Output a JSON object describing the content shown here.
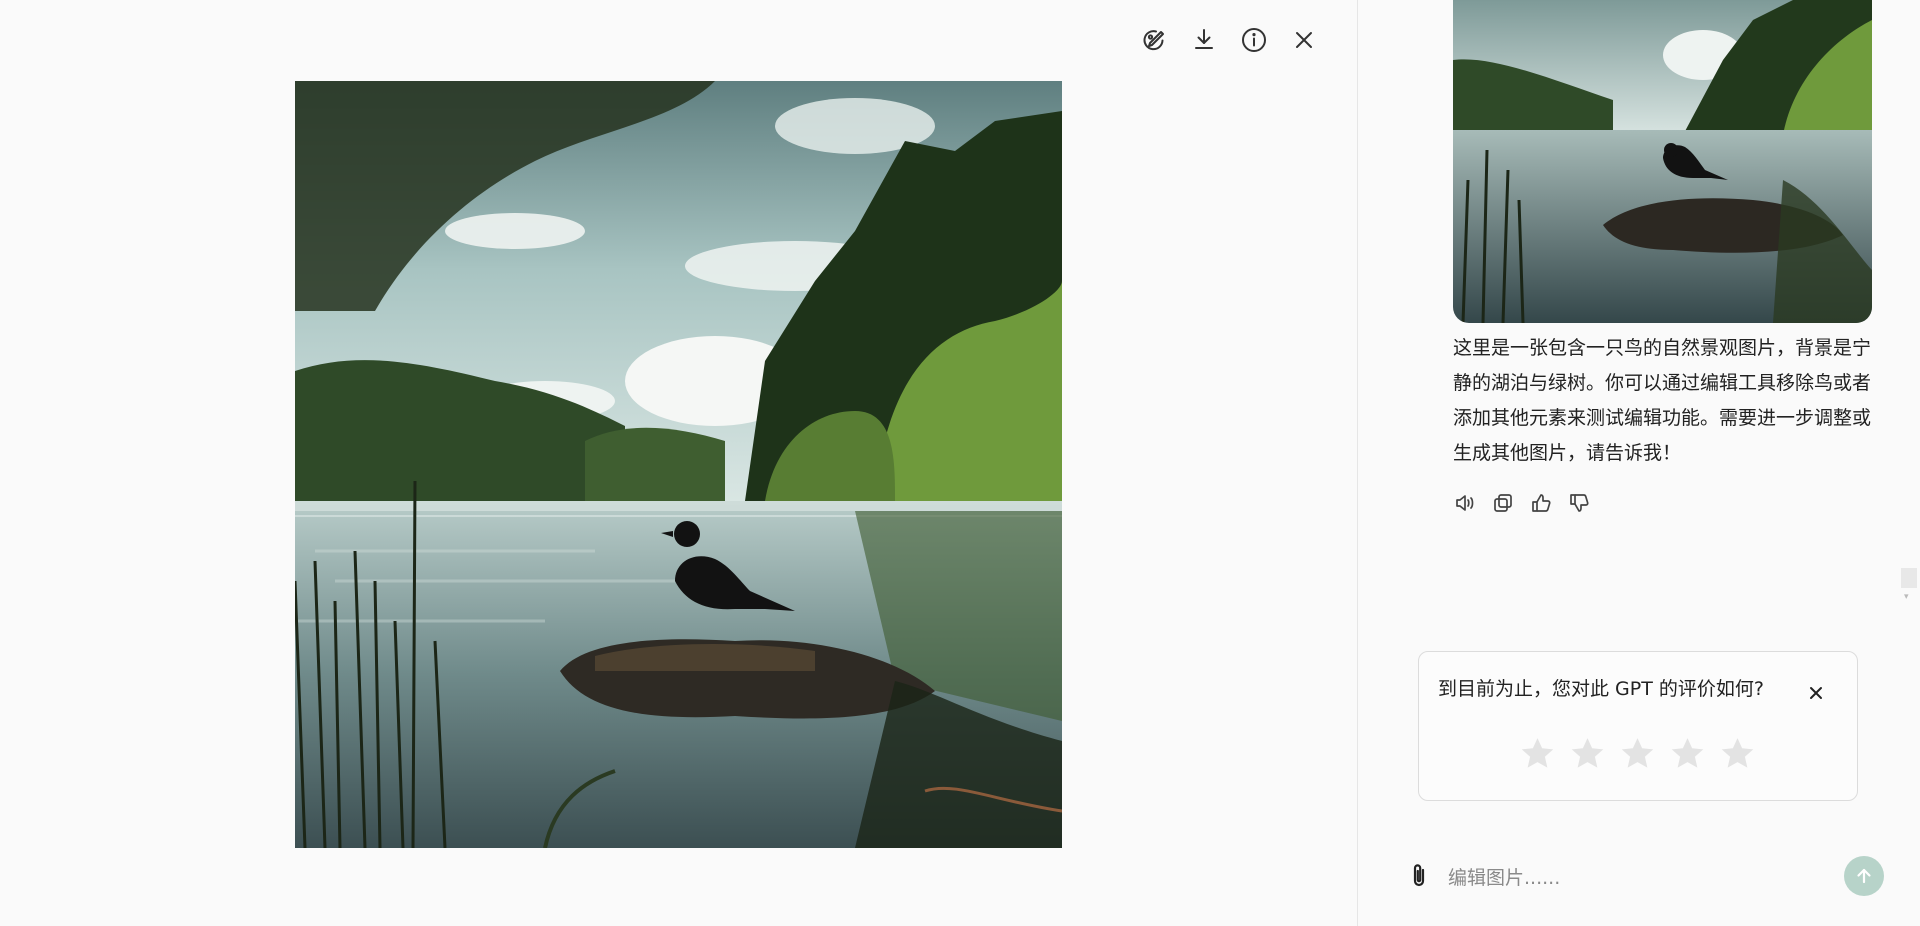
{
  "toolbar": {
    "buttons": [
      {
        "icon": "edit-image-icon"
      },
      {
        "icon": "download-icon"
      },
      {
        "icon": "info-icon"
      },
      {
        "icon": "close-icon"
      }
    ]
  },
  "preview": {
    "subject": "bird-on-rock-lake-scene"
  },
  "chat": {
    "message": "这里是一张包含一只鸟的自然景观图片，背景是宁静的湖泊与绿树。你可以通过编辑工具移除鸟或者添加其他元素来测试编辑功能。需要进一步调整或生成其他图片，请告诉我！",
    "actions": [
      "read-aloud-icon",
      "copy-icon",
      "thumbs-up-icon",
      "thumbs-down-icon"
    ]
  },
  "rating": {
    "question": "到目前为止，您对此 GPT 的评价如何?",
    "stars_total": 5
  },
  "composer": {
    "placeholder": "编辑图片......"
  },
  "colors": {
    "background": "#fafafa",
    "send_button": "#b7d3c9",
    "star": "#e3e3e3"
  }
}
